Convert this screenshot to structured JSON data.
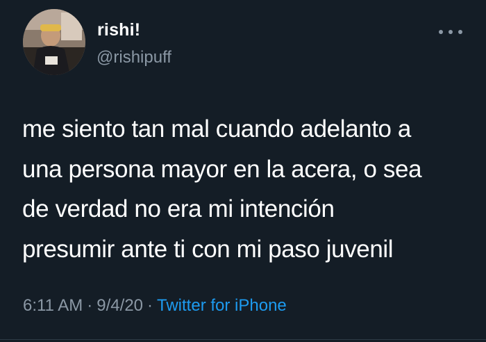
{
  "user": {
    "display_name": "rishi!",
    "handle": "@rishipuff"
  },
  "tweet": {
    "lines": [
      "me siento tan mal cuando adelanto a",
      "una persona mayor en la acera, o sea",
      "de verdad no era mi intención",
      "presumir ante ti con mi paso juvenil"
    ],
    "time": "6:11 AM",
    "date": "9/4/20",
    "source": "Twitter for iPhone",
    "separator": "·"
  },
  "icons": {
    "avatar": "profile-photo",
    "more": "more-dots-icon"
  },
  "colors": {
    "background": "#141d26",
    "secondary_text": "#8b98a5",
    "link": "#1d9bf0"
  }
}
